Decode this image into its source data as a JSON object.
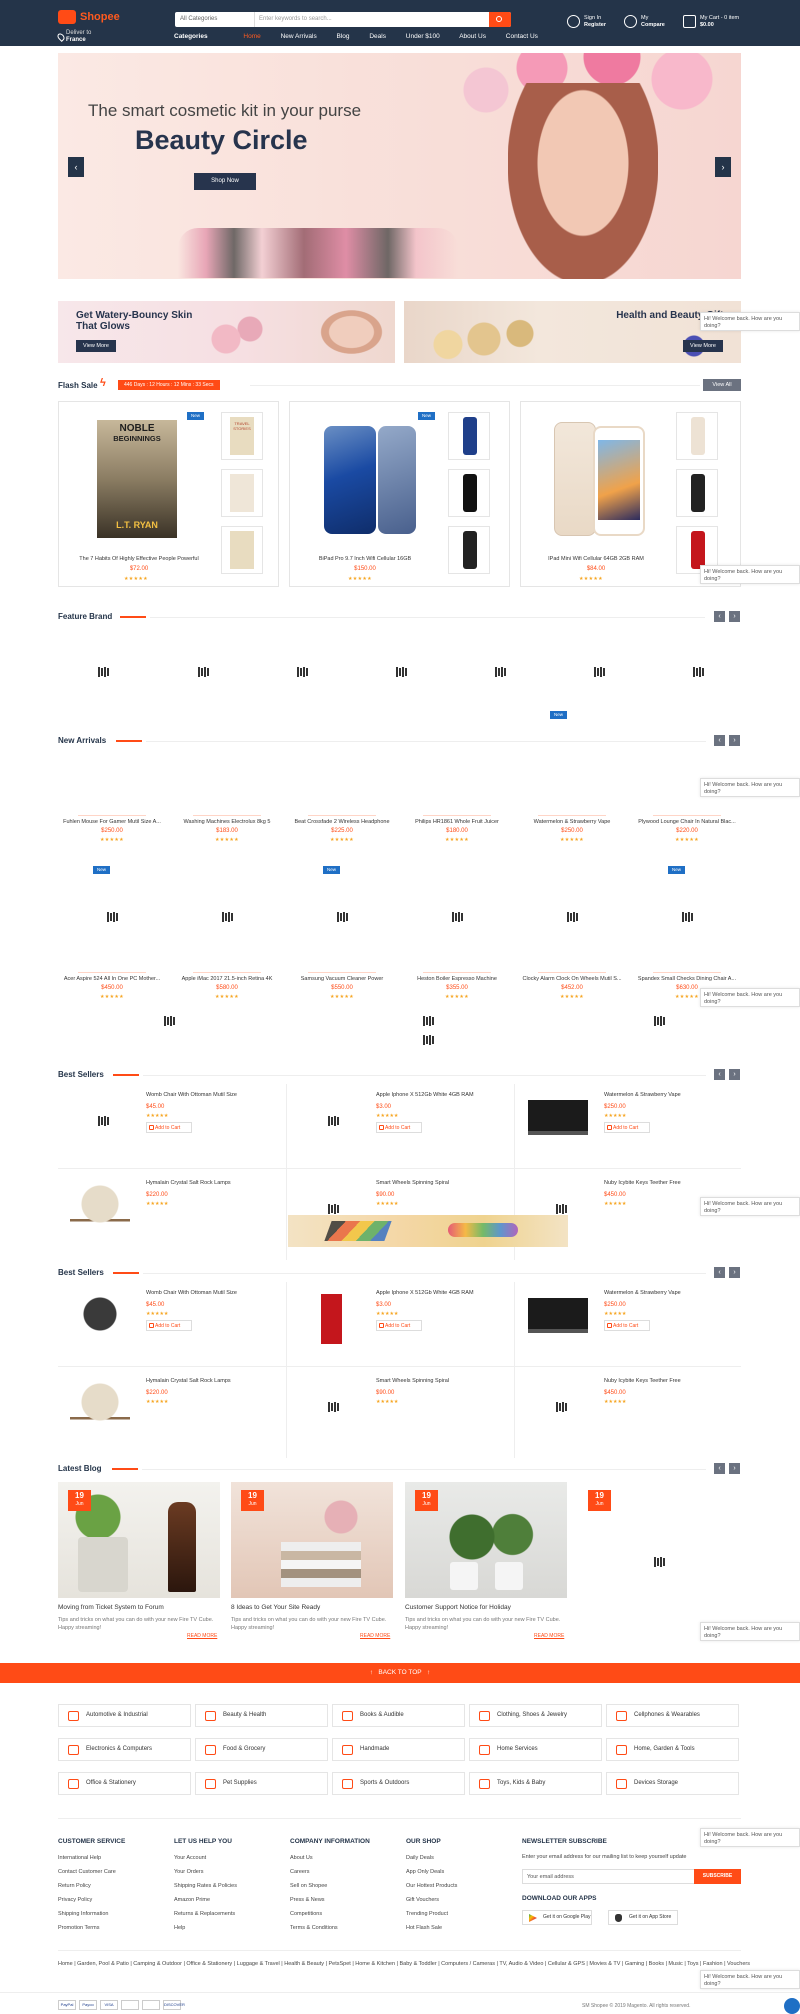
{
  "header": {
    "logo": "Shopee",
    "deliver_line1": "Deliver to",
    "deliver_line2": "France",
    "search_category": "All Categories",
    "search_placeholder": "Enter keywords to search...",
    "nav": [
      "Categories",
      "Home",
      "New Arrivals",
      "Blog",
      "Deals",
      "Under $100",
      "About Us",
      "Contact Us"
    ],
    "signin_line1": "Sign In",
    "signin_line2": "Register",
    "compare_line1": "My",
    "compare_line2": "Compare",
    "cart_line1": "My Cart - 0 item",
    "cart_line2": "$0.00"
  },
  "banner": {
    "subtitle": "The smart cosmetic kit in your purse",
    "title": "Beauty Circle",
    "button": "Shop Now"
  },
  "promos": [
    {
      "title": "Get Watery-Bouncy Skin That Glows",
      "button": "View More"
    },
    {
      "title": "Health and Beauty Gift and Pres",
      "button": "View More"
    }
  ],
  "flash": {
    "title": "Flash Sale",
    "countdown": "446 Days : 12 Hours : 12 Mins : 33 Secs",
    "view_all": "View All",
    "items": [
      {
        "badge": "New",
        "title": "The 7 Habits Of Highly Effective People Powerful",
        "price": "$72.00",
        "stars": "★★★★★"
      },
      {
        "badge": "New",
        "title": "BiPad Pro 9.7 Inch Wifi Cellular 16GB",
        "price": "$150.00",
        "stars": "★★★★★"
      },
      {
        "badge": "",
        "title": "IPad Mini Wifi Cellular 64GB 2GB RAM",
        "price": "$84.00",
        "stars": "★★★★★"
      }
    ],
    "book_cover": {
      "top": "NOBLE",
      "middle": "BEGINNINGS",
      "author": "L.T. RYAN"
    },
    "thumb_book": {
      "line1": "TRAVEL",
      "line2": "STORIES"
    }
  },
  "feature_brand": {
    "title": "Feature Brand"
  },
  "new_arrivals": {
    "title": "New Arrivals",
    "badge": "New",
    "row1": [
      {
        "title": "Fuhlen Mouse For Gamer Mutil Size A...",
        "price": "$250.00",
        "stars": "★★★★★"
      },
      {
        "title": "Washing Machines Electrolux 8kg 5",
        "price": "$183.00",
        "stars": "★★★★★"
      },
      {
        "title": "Beat Crossfade 2 Wireless Headphone",
        "price": "$225.00",
        "stars": "★★★★★"
      },
      {
        "title": "Philips HR1861 Whole Fruit Juicer",
        "price": "$180.00",
        "stars": "★★★★★"
      },
      {
        "title": "Watermelon & Strawberry Vape",
        "price": "$250.00",
        "stars": "★★★★★"
      },
      {
        "title": "Plywood Lounge Chair In Natural Blac...",
        "price": "$220.00",
        "stars": "★★★★★"
      }
    ],
    "row2": [
      {
        "title": "Acer Aspire 524 All In One PC Mother...",
        "price": "$450.00",
        "stars": "★★★★★"
      },
      {
        "title": "Apple iMac 2017 21.5-inch Retina 4K",
        "price": "$580.00",
        "stars": "★★★★★"
      },
      {
        "title": "Samsung Vacuum Cleaner Power",
        "price": "$550.00",
        "stars": "★★★★★"
      },
      {
        "title": "Heston Boiler Espresso Machine",
        "price": "$355.00",
        "stars": "★★★★★"
      },
      {
        "title": "Clocky Alarm Clock On Wheels Mutil S...",
        "price": "$452.00",
        "stars": "★★★★★"
      },
      {
        "title": "Spandex Small Checks Dining Chair A...",
        "price": "$630.00",
        "stars": "★★★★★"
      }
    ]
  },
  "best_sellers_1": {
    "title": "Best Sellers",
    "items": [
      {
        "name": "Womb Chair With Ottoman Mutil Size",
        "price": "$45.00",
        "stars": "★★★★★",
        "cart": "Add to Cart"
      },
      {
        "name": "Apple Iphone X 512Gb White 4GB RAM",
        "price": "$3.00",
        "stars": "★★★★★",
        "cart": "Add to Cart"
      },
      {
        "name": "Watermelon & Strawberry Vape",
        "price": "$250.00",
        "stars": "★★★★★",
        "cart": "Add to Cart"
      },
      {
        "name": "Hymalain Crystal Salt Rock Lamps",
        "price": "$220.00",
        "stars": "★★★★★"
      },
      {
        "name": "Smart Wheels Spinning Spiral",
        "price": "$90.00",
        "stars": "★★★★★"
      },
      {
        "name": "Nuby Icybite Keys Teether Free",
        "price": "$450.00",
        "stars": "★★★★★"
      }
    ]
  },
  "best_sellers_2": {
    "title": "Best Sellers",
    "items": [
      {
        "name": "Womb Chair With Ottoman Mutil Size",
        "price": "$45.00",
        "stars": "★★★★★",
        "cart": "Add to Cart"
      },
      {
        "name": "Apple Iphone X 512Gb White 4GB RAM",
        "price": "$3.00",
        "stars": "★★★★★",
        "cart": "Add to Cart"
      },
      {
        "name": "Watermelon & Strawberry Vape",
        "price": "$250.00",
        "stars": "★★★★★",
        "cart": "Add to Cart"
      },
      {
        "name": "Hymalain Crystal Salt Rock Lamps",
        "price": "$220.00",
        "stars": "★★★★★"
      },
      {
        "name": "Smart Wheels Spinning Spiral",
        "price": "$90.00",
        "stars": "★★★★★"
      },
      {
        "name": "Nuby Icybite Keys Teether Free",
        "price": "$450.00",
        "stars": "★★★★★"
      }
    ]
  },
  "blog": {
    "title": "Latest Blog",
    "posts": [
      {
        "day": "19",
        "month": "Jun",
        "title": "Moving from Ticket System to Forum",
        "desc": "Tips and tricks on what you can do with your new Fire TV Cube. Happy streaming!",
        "more": "READ MORE"
      },
      {
        "day": "19",
        "month": "Jun",
        "title": "8 Ideas to Get Your Site Ready",
        "desc": "Tips and tricks on what you can do with your new Fire TV Cube. Happy streaming!",
        "more": "READ MORE"
      },
      {
        "day": "19",
        "month": "Jun",
        "title": "Customer Support Notice for Holiday",
        "desc": "Tips and tricks on what you can do with your new Fire TV Cube. Happy streaming!",
        "more": "READ MORE"
      },
      {
        "day": "19",
        "month": "Jun"
      }
    ]
  },
  "chat": "Hi! Welcome back. How are you doing?",
  "back_to_top": "BACK TO TOP",
  "categories": [
    "Automotive & Industrial",
    "Beauty & Health",
    "Books & Audible",
    "Clothing, Shoes & Jewelry",
    "Cellphones & Wearables",
    "Electronics & Computers",
    "Food & Grocery",
    "Handmade",
    "Home Services",
    "Home, Garden & Tools",
    "Office & Stationery",
    "Pet Supplies",
    "Sports & Outdoors",
    "Toys, Kids & Baby",
    "Devices Storage"
  ],
  "footer": {
    "columns": [
      {
        "title": "CUSTOMER SERVICE",
        "links": [
          "International Help",
          "Contact Customer Care",
          "Return Policy",
          "Privacy Policy",
          "Shipping Information",
          "Promotion Terms"
        ]
      },
      {
        "title": "LET US HELP YOU",
        "links": [
          "Your Account",
          "Your Orders",
          "Shipping Rates & Policies",
          "Amazon Prime",
          "Returns & Replacements",
          "Help"
        ]
      },
      {
        "title": "COMPANY INFORMATION",
        "links": [
          "About Us",
          "Careers",
          "Sell on Shopee",
          "Press & News",
          "Competitions",
          "Terms & Conditions"
        ]
      },
      {
        "title": "OUR SHOP",
        "links": [
          "Daily Deals",
          "App Only Deals",
          "Our Hottest Products",
          "Gift Vouchers",
          "Trending Product",
          "Hot Flash Sale"
        ]
      }
    ],
    "newsletter_title": "NEWSLETTER SUBSCRIBE",
    "newsletter_text": "Enter your email address for our mailing list to keep yourself update",
    "email_placeholder": "Your email address",
    "subscribe": "SUBSCRIBE",
    "apps_title": "DOWNLOAD OUR APPS",
    "google_play": "Get it on Google Play",
    "app_store": "Get it on App Store",
    "tags": "Home | Garden, Pool & Patio | Camping & Outdoor | Office & Stationery | Luggage & Travel | Health & Beauty | PetsSpet | Home & Kitchen | Baby & Toddler | Computers / Cameras | TV, Audio & Video | Cellular & GPS | Movies & TV | Gaming | Books | Music | Toys | Fashion | Vouchers",
    "payments": [
      "PayPal",
      "Payoo",
      "VISA",
      "",
      "",
      "DISCOVER"
    ],
    "copyright": "SM Shopee © 2019 Magento. All rights reserved."
  }
}
